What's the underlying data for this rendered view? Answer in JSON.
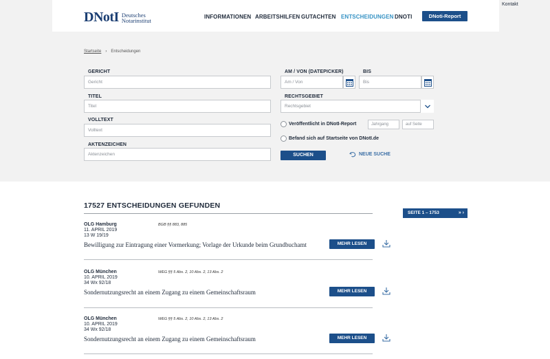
{
  "header": {
    "logo_mark": "DNotI",
    "logo_line1": "Deutsches",
    "logo_line2": "Notarinstitut",
    "kontakt": "Kontakt",
    "nav": [
      {
        "label": "INFORMATIONEN",
        "active": false
      },
      {
        "label": "ARBEITSHILFEN",
        "active": false
      },
      {
        "label": "GUTACHTEN",
        "active": false
      },
      {
        "label": "ENTSCHEIDUNGEN",
        "active": true
      },
      {
        "label": "DNOTI",
        "active": false
      }
    ],
    "report_button": "DNoti-Report"
  },
  "breadcrumb": {
    "home": "Startseite",
    "separator": "›",
    "current": "Entscheidungen"
  },
  "form": {
    "gericht": {
      "label": "GERICHT",
      "placeholder": "Gericht",
      "value": ""
    },
    "titel": {
      "label": "TITEL",
      "placeholder": "Titel",
      "value": ""
    },
    "volltext": {
      "label": "VOLLTEXT",
      "placeholder": "Volltext",
      "value": ""
    },
    "aktenzeichen": {
      "label": "AKTENZEICHEN",
      "placeholder": "Aktenzeichen",
      "value": ""
    },
    "am_von": {
      "label": "AM / VON (DATEPICKER)",
      "placeholder": "Am / Von",
      "value": ""
    },
    "bis": {
      "label": "BIS",
      "placeholder": "Bis",
      "value": ""
    },
    "rechtsgebiet": {
      "label": "RECHTSGEBIET",
      "selected": "Rechtsgebiet"
    },
    "report_option": {
      "label": "Veröffentlicht in DNotI-Report",
      "checked": false
    },
    "jahrgang": {
      "placeholder": "Jahrgang"
    },
    "auf_seite": {
      "placeholder": "auf Seite"
    },
    "startseite_option": {
      "label": "Befand sich auf Startseite von DNotI.de",
      "checked": false
    },
    "search_button": "SUCHEN",
    "new_search": "NEUE SUCHE"
  },
  "results": {
    "heading": "17527 ENTSCHEIDUNGEN GEFUNDEN",
    "pager": "SEITE 1 – 1753",
    "more_label": "MEHR LESEN",
    "items": [
      {
        "court": "OLG Hamburg",
        "norms": "BGB §§ 883, 885",
        "date": "11. APRIL 2019",
        "az": "13 W 19/19",
        "title": "Bewilligung zur Eintragung einer Vormerkung; Vorlage der Urkunde beim Grundbuchamt"
      },
      {
        "court": "OLG München",
        "norms": "WEG §§ 5 Abs. 2, 10 Abs. 2, 13 Abs. 2",
        "date": "10. APRIL 2019",
        "az": "34 Wx 92/18",
        "title": "Sondernutzungsrecht an einem Zugang zu einem Gemeinschaftsraum"
      },
      {
        "court": "OLG München",
        "norms": "WEG §§ 5 Abs. 2, 10 Abs. 2, 13 Abs. 2",
        "date": "10. APRIL 2019",
        "az": "34 Wx 92/18",
        "title": "Sondernutzungsrecht an einem Zugang zu einem Gemeinschaftsraum"
      }
    ]
  },
  "colors": {
    "primary": "#1c4f8a",
    "active_nav": "#3592c4",
    "logo": "#1c3f73",
    "panel_bg": "#f2f2f2"
  }
}
